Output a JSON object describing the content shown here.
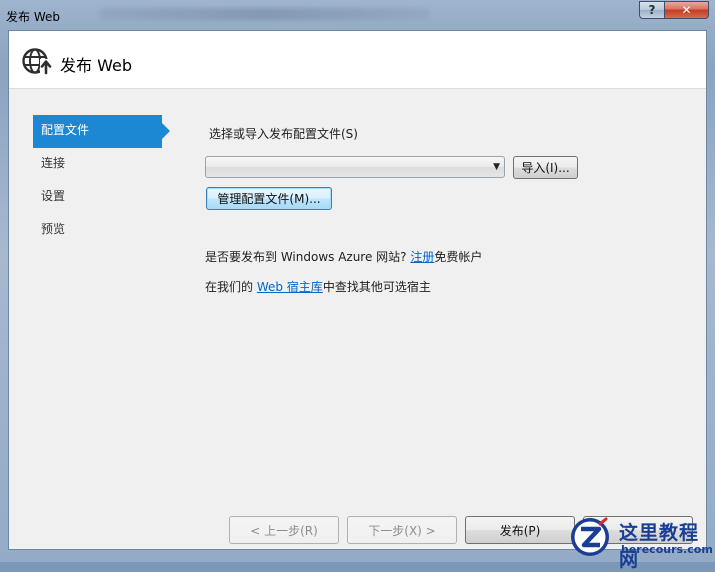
{
  "window": {
    "title": "发布 Web",
    "help_label": "?",
    "close_label": "✕"
  },
  "header": {
    "title": "发布 Web",
    "icon": "globe-publish-icon"
  },
  "nav": {
    "items": [
      {
        "label": "配置文件",
        "active": true
      },
      {
        "label": "连接",
        "active": false
      },
      {
        "label": "设置",
        "active": false
      },
      {
        "label": "预览",
        "active": false
      }
    ]
  },
  "profile": {
    "prompt": "选择或导入发布配置文件(S)",
    "combo_value": "",
    "import_label": "导入(I)...",
    "manage_label": "管理配置文件(M)..."
  },
  "azure": {
    "text": "是否要发布到 Windows Azure 网站? ",
    "link": "注册",
    "suffix": "免费帐户"
  },
  "hosting": {
    "prefix": "在我们的 ",
    "link": "Web 宿主库",
    "suffix": "中查找其他可选宿主"
  },
  "footer": {
    "back_label": "< 上一步(R)",
    "next_label": "下一步(X) >",
    "publish_label": "发布(P)",
    "close_label": ""
  },
  "watermark": {
    "cn": "这里教程网",
    "en": "herecours.com"
  },
  "colors": {
    "accent": "#1c88d4",
    "link": "#0066cc"
  }
}
